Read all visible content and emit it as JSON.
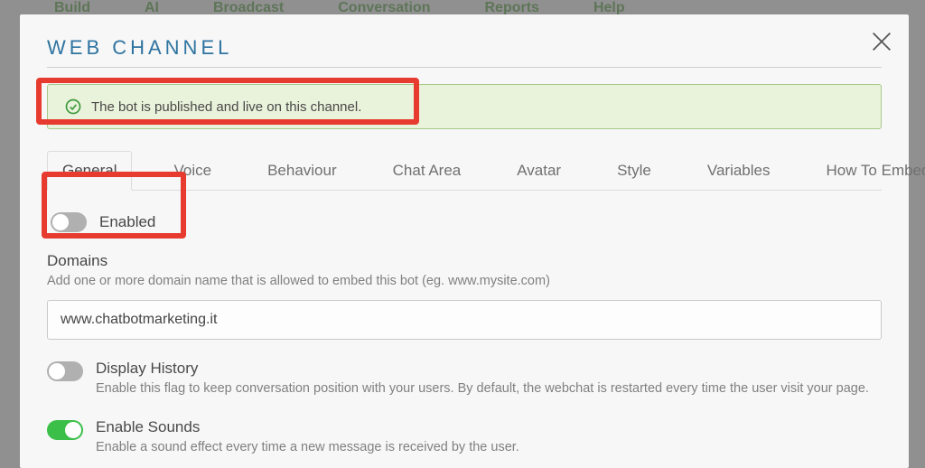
{
  "bg_nav": [
    "Build",
    "AI",
    "Broadcast",
    "Conversation",
    "Reports",
    "Help"
  ],
  "modal": {
    "title": "WEB CHANNEL",
    "alert": "The bot is published and live on this channel.",
    "tabs": [
      "General",
      "Voice",
      "Behaviour",
      "Chat Area",
      "Avatar",
      "Style",
      "Variables",
      "How To Embed"
    ],
    "active_tab": 0,
    "enabled_label": "Enabled",
    "domains": {
      "label": "Domains",
      "help": "Add one or more domain name that is allowed to embed this bot (eg. www.mysite.com)",
      "value": "www.chatbotmarketing.it"
    },
    "display_history": {
      "label": "Display History",
      "help": "Enable this flag to keep conversation position with your users. By default, the webchat is restarted every time the user visit your page.",
      "on": false
    },
    "enable_sounds": {
      "label": "Enable Sounds",
      "help": "Enable a sound effect every time a new message is received by the user.",
      "on": true
    }
  }
}
